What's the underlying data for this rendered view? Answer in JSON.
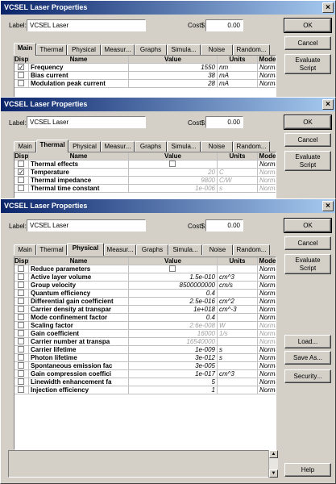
{
  "windows": [
    {
      "title": "VCSEL Laser Properties",
      "close_glyph": "×",
      "label_caption": "Label:",
      "label_value": "VCSEL Laser",
      "cost_caption": "Cost$:",
      "cost_value": "0.00",
      "buttons": {
        "ok": "OK",
        "cancel": "Cancel",
        "evaluate_line1": "Evaluate",
        "evaluate_line2": "Script"
      },
      "tabs": [
        "Main",
        "Thermal",
        "Physical",
        "Measur...",
        "Graphs",
        "Simula...",
        "Noise",
        "Random..."
      ],
      "selected_tab": 0,
      "columns": [
        "Disp",
        "Name",
        "Value",
        "Units",
        "Mode"
      ],
      "rows": [
        {
          "disp": true,
          "name": "Frequency",
          "value": "1550",
          "units": "nm",
          "mode": "Normal"
        },
        {
          "disp": false,
          "name": "Bias current",
          "value": "38",
          "units": "mA",
          "mode": "Normal"
        },
        {
          "disp": false,
          "name": "Modulation peak current",
          "value": "28",
          "units": "mA",
          "mode": "Normal"
        }
      ]
    },
    {
      "title": "VCSEL Laser Properties",
      "close_glyph": "×",
      "label_caption": "Label:",
      "label_value": "VCSEL Laser",
      "cost_caption": "Cost$:",
      "cost_value": "0.00",
      "buttons": {
        "ok": "OK",
        "cancel": "Cancel",
        "evaluate_line1": "Evaluate",
        "evaluate_line2": "Script"
      },
      "tabs": [
        "Main",
        "Thermal",
        "Physical",
        "Measur...",
        "Graphs",
        "Simula...",
        "Noise",
        "Random..."
      ],
      "selected_tab": 1,
      "columns": [
        "Disp",
        "Name",
        "Value",
        "Units",
        "Mode"
      ],
      "rows": [
        {
          "disp": false,
          "name": "Thermal effects",
          "value": "",
          "checkbox_value": true,
          "units": "",
          "mode": "Normal"
        },
        {
          "disp": true,
          "name": "Temperature",
          "value": "20",
          "units": "C",
          "mode": "Normal",
          "readonly": true
        },
        {
          "disp": false,
          "name": "Thermal impedance",
          "value": "9800",
          "units": "C/W",
          "mode": "Normal",
          "readonly": true
        },
        {
          "disp": false,
          "name": "Thermal time constant",
          "value": "1e-006",
          "units": "s",
          "mode": "Normal",
          "readonly": true
        }
      ]
    },
    {
      "title": "VCSEL Laser Properties",
      "close_glyph": "×",
      "label_caption": "Label:",
      "label_value": "VCSEL Laser",
      "cost_caption": "Cost$:",
      "cost_value": "0.00",
      "buttons": {
        "ok": "OK",
        "cancel": "Cancel",
        "evaluate_line1": "Evaluate",
        "evaluate_line2": "Script",
        "load": "Load...",
        "save_as": "Save As...",
        "security": "Security...",
        "help": "Help"
      },
      "tabs": [
        "Main",
        "Thermal",
        "Physical",
        "Measur...",
        "Graphs",
        "Simula...",
        "Noise",
        "Random..."
      ],
      "selected_tab": 2,
      "columns": [
        "Disp",
        "Name",
        "Value",
        "Units",
        "Mode"
      ],
      "rows": [
        {
          "disp": false,
          "name": "Reduce parameters",
          "value": "",
          "checkbox_value": false,
          "units": "",
          "mode": "Normal"
        },
        {
          "disp": false,
          "name": "Active layer volume",
          "value": "1.5e-010",
          "units": "cm^3",
          "mode": "Normal"
        },
        {
          "disp": false,
          "name": "Group velocity",
          "value": "8500000000",
          "units": "cm/s",
          "mode": "Normal"
        },
        {
          "disp": false,
          "name": "Quantum efficiency",
          "value": "0.4",
          "units": "",
          "mode": "Normal"
        },
        {
          "disp": false,
          "name": "Differential gain coefficient",
          "value": "2.5e-016",
          "units": "cm^2",
          "mode": "Normal"
        },
        {
          "disp": false,
          "name": "Carrier density at transpar",
          "value": "1e+018",
          "units": "cm^-3",
          "mode": "Normal"
        },
        {
          "disp": false,
          "name": "Mode confinement factor",
          "value": "0.4",
          "units": "",
          "mode": "Normal"
        },
        {
          "disp": false,
          "name": "Scaling factor",
          "value": "2.6e-008",
          "units": "W",
          "mode": "Normal",
          "readonly": true
        },
        {
          "disp": false,
          "name": "Gain coefficient",
          "value": "16000",
          "units": "1/s",
          "mode": "Normal",
          "readonly": true
        },
        {
          "disp": false,
          "name": "Carrier number at transpa",
          "value": "16540000",
          "units": "",
          "mode": "Normal",
          "readonly": true
        },
        {
          "disp": false,
          "name": "Carrier lifetime",
          "value": "1e-009",
          "units": "s",
          "mode": "Normal"
        },
        {
          "disp": false,
          "name": "Photon lifetime",
          "value": "3e-012",
          "units": "s",
          "mode": "Normal"
        },
        {
          "disp": false,
          "name": "Spontaneous emission fac",
          "value": "3e-005",
          "units": "",
          "mode": "Normal"
        },
        {
          "disp": false,
          "name": "Gain compression coeffici",
          "value": "1e-017",
          "units": "cm^3",
          "mode": "Normal"
        },
        {
          "disp": false,
          "name": "Linewidth enhancement fa",
          "value": "5",
          "units": "",
          "mode": "Normal"
        },
        {
          "disp": false,
          "name": "Injection efficiency",
          "value": "1",
          "units": "",
          "mode": "Normal"
        }
      ]
    }
  ]
}
